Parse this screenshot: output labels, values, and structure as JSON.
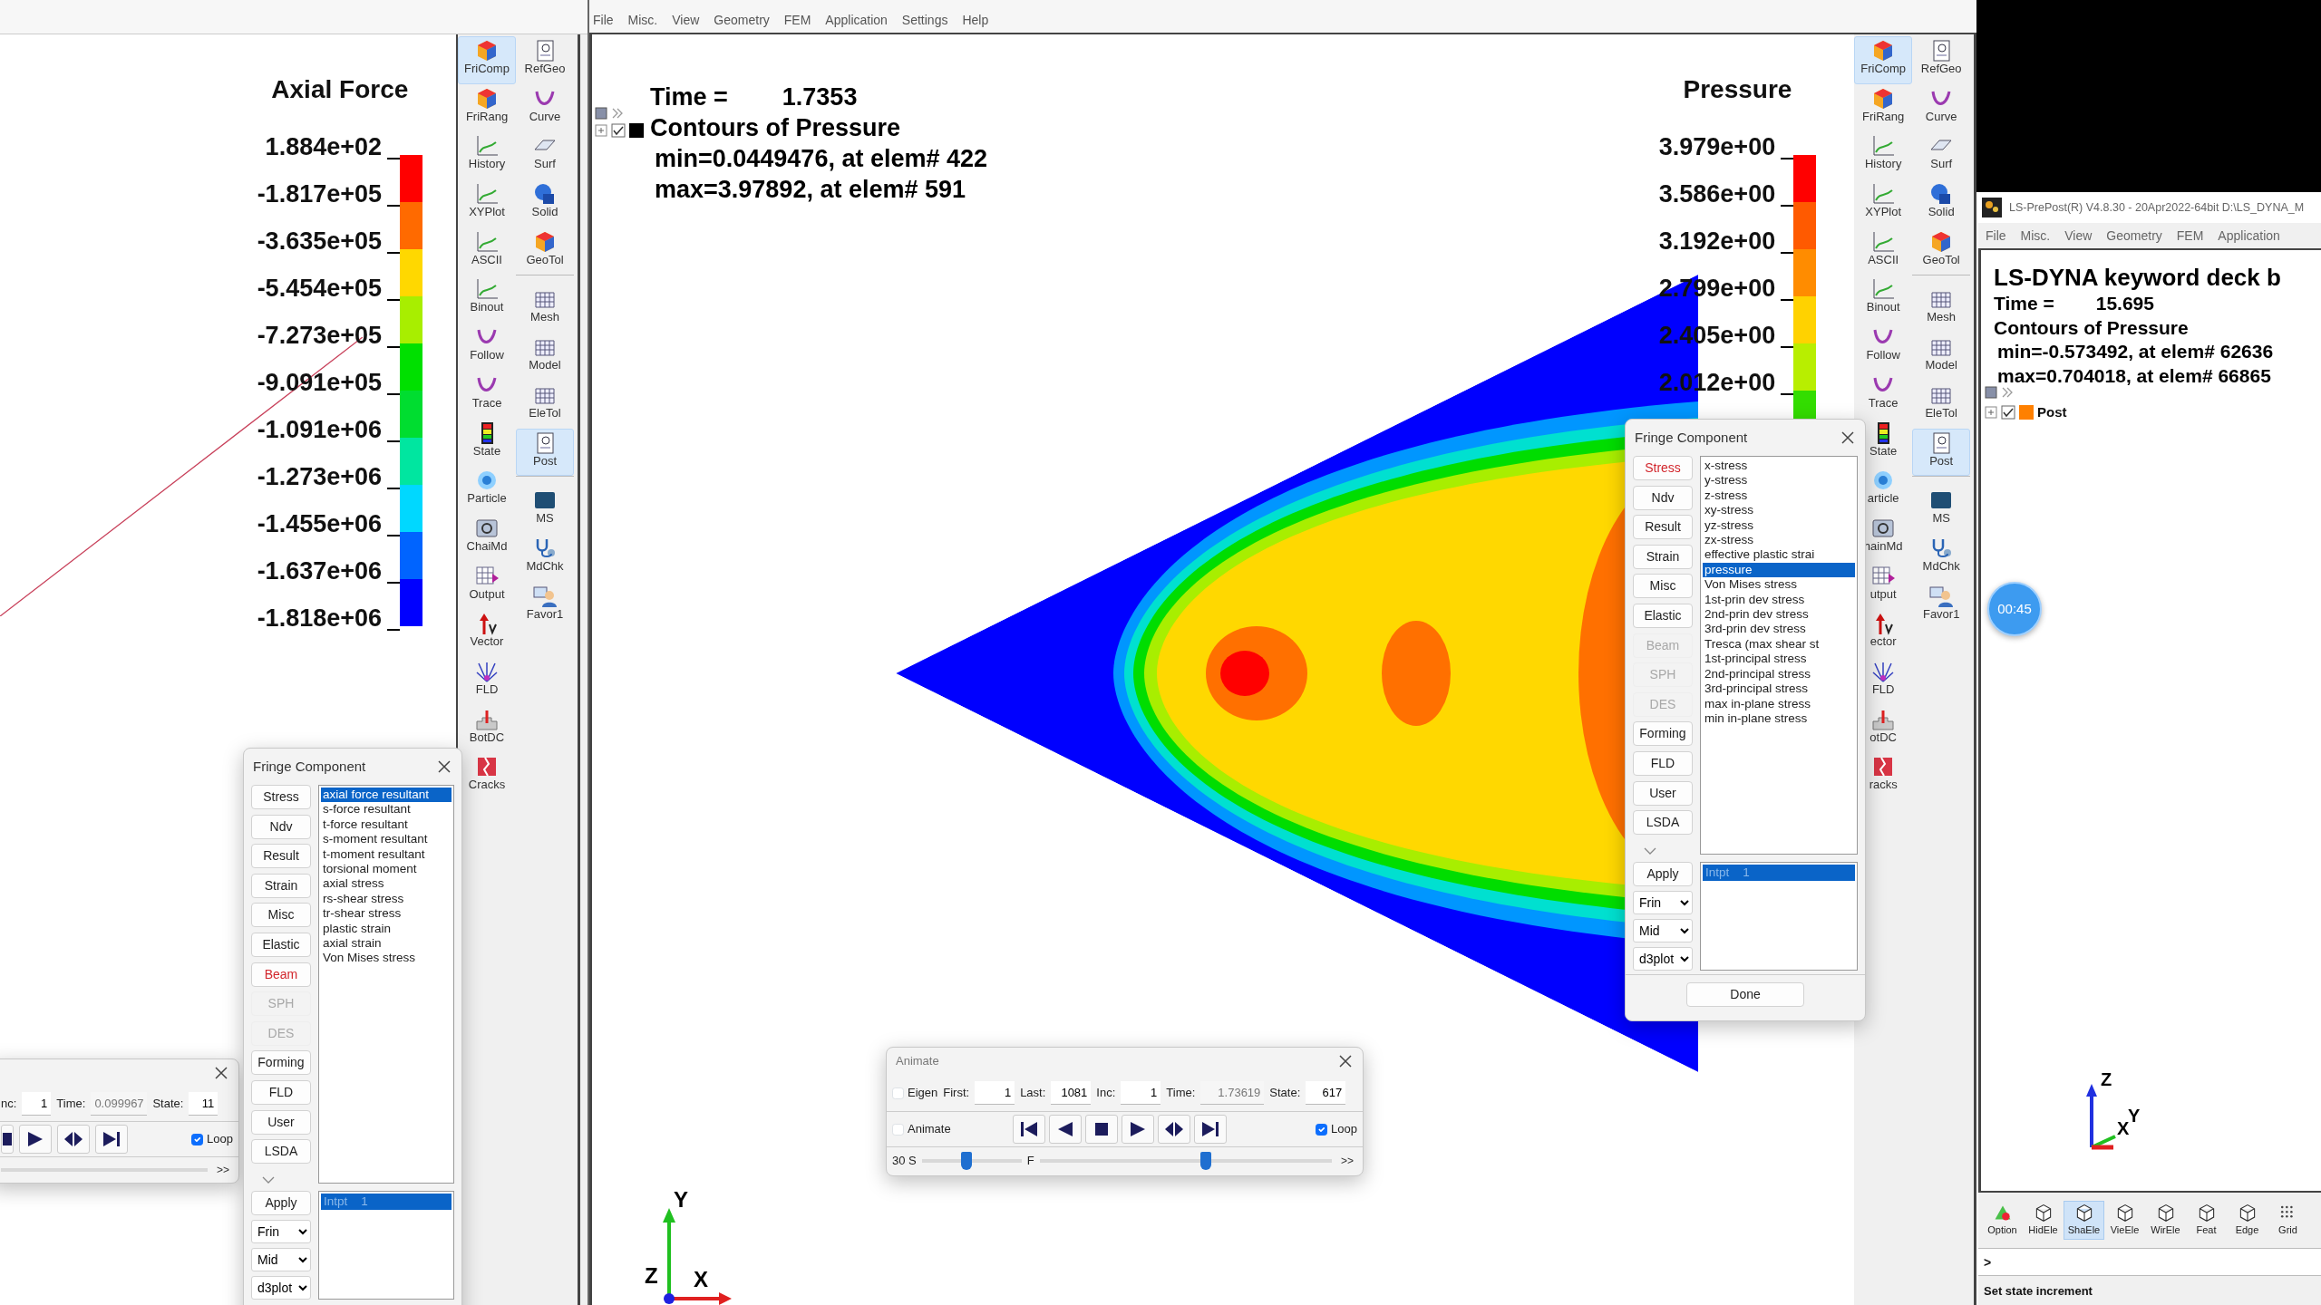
{
  "left_window": {
    "legend": {
      "title": "Axial Force",
      "values": [
        "1.884e+02",
        "-1.817e+05",
        "-3.635e+05",
        "-5.454e+05",
        "-7.273e+05",
        "-9.091e+05",
        "-1.091e+06",
        "-1.273e+06",
        "-1.455e+06",
        "-1.637e+06",
        "-1.818e+06"
      ]
    },
    "toolbar": {
      "column_1": [
        {
          "label": "FriComp",
          "selected": true
        },
        {
          "label": "FriRang",
          "selected": false
        },
        {
          "label": "History",
          "selected": false
        },
        {
          "label": "XYPlot",
          "selected": false
        },
        {
          "label": "ASCII",
          "selected": false
        },
        {
          "label": "Binout",
          "selected": false
        },
        {
          "label": "Follow",
          "selected": false
        },
        {
          "label": "Trace",
          "selected": false
        },
        {
          "label": "State",
          "selected": false
        },
        {
          "label": "Particle",
          "selected": false
        },
        {
          "label": "ChaiMd",
          "selected": false
        },
        {
          "label": "Output",
          "selected": false
        },
        {
          "label": "Vector",
          "selected": false
        },
        {
          "label": "FLD",
          "selected": false
        },
        {
          "label": "BotDC",
          "selected": false
        },
        {
          "label": "Cracks",
          "selected": false
        }
      ],
      "column_2": [
        {
          "label": "RefGeo",
          "selected": false
        },
        {
          "label": "Curve",
          "selected": false
        },
        {
          "label": "Surf",
          "selected": false
        },
        {
          "label": "Solid",
          "selected": false
        },
        {
          "label": "GeoTol",
          "selected": false
        },
        {
          "label": "Mesh",
          "selected": false
        },
        {
          "label": "Model",
          "selected": false
        },
        {
          "label": "EleTol",
          "selected": false
        },
        {
          "label": "Post",
          "selected": true
        },
        {
          "label": "MS",
          "selected": false
        },
        {
          "label": "MdChk",
          "selected": false
        },
        {
          "label": "Favor1",
          "selected": false
        }
      ]
    },
    "fringe_panel": {
      "title": "Fringe Component",
      "categories": [
        {
          "label": "Stress",
          "selected": false,
          "disabled": false
        },
        {
          "label": "Ndv",
          "selected": false,
          "disabled": false
        },
        {
          "label": "Result",
          "selected": false,
          "disabled": false
        },
        {
          "label": "Strain",
          "selected": false,
          "disabled": false
        },
        {
          "label": "Misc",
          "selected": false,
          "disabled": false
        },
        {
          "label": "Elastic",
          "selected": false,
          "disabled": false
        },
        {
          "label": "Beam",
          "selected": true,
          "disabled": false
        },
        {
          "label": "SPH",
          "selected": false,
          "disabled": true
        },
        {
          "label": "DES",
          "selected": false,
          "disabled": true
        },
        {
          "label": "Forming",
          "selected": false,
          "disabled": false
        },
        {
          "label": "FLD",
          "selected": false,
          "disabled": false
        },
        {
          "label": "User",
          "selected": false,
          "disabled": false
        },
        {
          "label": "LSDA",
          "selected": false,
          "disabled": false
        }
      ],
      "components": [
        {
          "label": "axial force resultant",
          "selected": true
        },
        {
          "label": "s-force resultant",
          "selected": false
        },
        {
          "label": "t-force resultant",
          "selected": false
        },
        {
          "label": "s-moment resultant",
          "selected": false
        },
        {
          "label": "t-moment resultant",
          "selected": false
        },
        {
          "label": "torsional moment",
          "selected": false
        },
        {
          "label": "axial stress",
          "selected": false
        },
        {
          "label": "rs-shear stress",
          "selected": false
        },
        {
          "label": "tr-shear stress",
          "selected": false
        },
        {
          "label": "plastic strain",
          "selected": false
        },
        {
          "label": "axial strain",
          "selected": false
        },
        {
          "label": "Von Mises stress",
          "selected": false
        }
      ],
      "integration_points": [
        {
          "label": "Intpt    1",
          "selected": true
        }
      ],
      "apply": "Apply",
      "dropdowns": [
        "Frin",
        "Mid",
        "d3plot"
      ]
    },
    "animate_panel": {
      "fields": [
        {
          "label": "nc:",
          "value": "1",
          "disabled": false
        },
        {
          "label": "Time:",
          "value": "0.099967",
          "disabled": true
        },
        {
          "label": "State:",
          "value": "11",
          "disabled": false
        }
      ],
      "loop": {
        "label": "Loop",
        "checked": true
      },
      "more": ">>"
    }
  },
  "main_window": {
    "menu": [
      "File",
      "Misc.",
      "View",
      "Geometry",
      "FEM",
      "Application",
      "Settings",
      "Help"
    ],
    "info": {
      "time_label": "Time =",
      "time": "1.7353",
      "title": "Contours of Pressure",
      "min": "min=0.0449476, at elem# 422",
      "max": "max=3.97892, at elem# 591"
    },
    "tree": [
      {
        "checked": true,
        "color": "#000000"
      }
    ],
    "legend": {
      "title": "Pressure",
      "values": [
        "3.979e+00",
        "3.586e+00",
        "3.192e+00",
        "2.799e+00",
        "2.405e+00",
        "2.012e+00"
      ]
    },
    "axis_labels": [
      "Y",
      "Z",
      "X"
    ],
    "toolbar": {
      "column_1": [
        {
          "label": "FriComp",
          "selected": true
        },
        {
          "label": "FriRang",
          "selected": false
        },
        {
          "label": "History",
          "selected": false
        },
        {
          "label": "XYPlot",
          "selected": false
        },
        {
          "label": "ASCII",
          "selected": false
        },
        {
          "label": "Binout",
          "selected": false
        },
        {
          "label": "Follow",
          "selected": false
        },
        {
          "label": "Trace",
          "selected": false
        },
        {
          "label": "State",
          "selected": false
        },
        {
          "label": "article",
          "selected": false
        },
        {
          "label": "hainMd",
          "selected": false
        },
        {
          "label": "utput",
          "selected": false
        },
        {
          "label": "ector",
          "selected": false
        },
        {
          "label": "FLD",
          "selected": false
        },
        {
          "label": "otDC",
          "selected": false
        },
        {
          "label": "racks",
          "selected": false
        }
      ],
      "column_2": [
        {
          "label": "RefGeo",
          "selected": false
        },
        {
          "label": "Curve",
          "selected": false
        },
        {
          "label": "Surf",
          "selected": false
        },
        {
          "label": "Solid",
          "selected": false
        },
        {
          "label": "GeoTol",
          "selected": false
        },
        {
          "label": "Mesh",
          "selected": false
        },
        {
          "label": "Model",
          "selected": false
        },
        {
          "label": "EleTol",
          "selected": false
        },
        {
          "label": "Post",
          "selected": true
        },
        {
          "label": "MS",
          "selected": false
        },
        {
          "label": "MdChk",
          "selected": false
        },
        {
          "label": "Favor1",
          "selected": false
        }
      ]
    },
    "fringe_panel": {
      "title": "Fringe Component",
      "categories": [
        {
          "label": "Stress",
          "selected": true,
          "disabled": false
        },
        {
          "label": "Ndv",
          "selected": false,
          "disabled": false
        },
        {
          "label": "Result",
          "selected": false,
          "disabled": false
        },
        {
          "label": "Strain",
          "selected": false,
          "disabled": false
        },
        {
          "label": "Misc",
          "selected": false,
          "disabled": false
        },
        {
          "label": "Elastic",
          "selected": false,
          "disabled": false
        },
        {
          "label": "Beam",
          "selected": false,
          "disabled": true
        },
        {
          "label": "SPH",
          "selected": false,
          "disabled": true
        },
        {
          "label": "DES",
          "selected": false,
          "disabled": true
        },
        {
          "label": "Forming",
          "selected": false,
          "disabled": false
        },
        {
          "label": "FLD",
          "selected": false,
          "disabled": false
        },
        {
          "label": "User",
          "selected": false,
          "disabled": false
        },
        {
          "label": "LSDA",
          "selected": false,
          "disabled": false
        }
      ],
      "components": [
        {
          "label": "x-stress",
          "selected": false
        },
        {
          "label": "y-stress",
          "selected": false
        },
        {
          "label": "z-stress",
          "selected": false
        },
        {
          "label": "xy-stress",
          "selected": false
        },
        {
          "label": "yz-stress",
          "selected": false
        },
        {
          "label": "zx-stress",
          "selected": false
        },
        {
          "label": "effective plastic strai",
          "selected": false
        },
        {
          "label": "pressure",
          "selected": true
        },
        {
          "label": "Von Mises stress",
          "selected": false
        },
        {
          "label": "1st-prin dev stress",
          "selected": false
        },
        {
          "label": "2nd-prin dev stress",
          "selected": false
        },
        {
          "label": "3rd-prin dev stress",
          "selected": false
        },
        {
          "label": "Tresca (max shear st",
          "selected": false
        },
        {
          "label": "1st-principal stress",
          "selected": false
        },
        {
          "label": "2nd-principal stress",
          "selected": false
        },
        {
          "label": "3rd-principal stress",
          "selected": false
        },
        {
          "label": "max in-plane stress",
          "selected": false
        },
        {
          "label": "min in-plane stress",
          "selected": false
        }
      ],
      "integration_points": [
        {
          "label": "Intpt    1",
          "selected": true
        }
      ],
      "apply": "Apply",
      "dropdowns": [
        "Frin",
        "Mid",
        "d3plot"
      ],
      "done": "Done"
    },
    "animate_panel": {
      "title": "Animate",
      "eigen": {
        "label": "Eigen",
        "checked": false
      },
      "fields": [
        {
          "label": "First:",
          "value": "1",
          "disabled": false
        },
        {
          "label": "Last:",
          "value": "1081",
          "disabled": false
        },
        {
          "label": "Inc:",
          "value": "1",
          "disabled": false
        },
        {
          "label": "Time:",
          "value": "1.73619",
          "disabled": true
        },
        {
          "label": "State:",
          "value": "617",
          "disabled": false
        }
      ],
      "animate": {
        "label": "Animate",
        "checked": false
      },
      "loop": {
        "label": "Loop",
        "checked": true
      },
      "speed": {
        "slow_label": "30 S",
        "fast_label": "F",
        "level": 0.45
      },
      "frame_slider": {
        "level": 0.57
      },
      "more": ">>"
    }
  },
  "prepost_window": {
    "title": "LS-PrePost(R) V4.8.30 - 20Apr2022-64bit D:\\LS_DYNA_M",
    "menu": [
      "File",
      "Misc.",
      "View",
      "Geometry",
      "FEM",
      "Application"
    ],
    "info": {
      "heading": "LS-DYNA keyword deck b",
      "time_label": "Time =",
      "time": "15.695",
      "title": "Contours of Pressure",
      "min": "min=-0.573492, at elem# 62636",
      "max": "max=0.704018, at elem# 66865"
    },
    "tree": [
      {
        "label": "Post",
        "checked": true,
        "color": "#ff8000"
      }
    ],
    "timer": "00:45",
    "axis_labels": [
      "Z",
      "Y",
      "X"
    ],
    "toolbar": [
      {
        "label": "Option",
        "selected": false
      },
      {
        "label": "HidEle",
        "selected": false
      },
      {
        "label": "ShaEle",
        "selected": true
      },
      {
        "label": "VieEle",
        "selected": false
      },
      {
        "label": "WirEle",
        "selected": false
      },
      {
        "label": "Feat",
        "selected": false
      },
      {
        "label": "Edge",
        "selected": false
      },
      {
        "label": "Grid",
        "selected": false
      }
    ],
    "command": ">",
    "status": "Set state increment"
  }
}
